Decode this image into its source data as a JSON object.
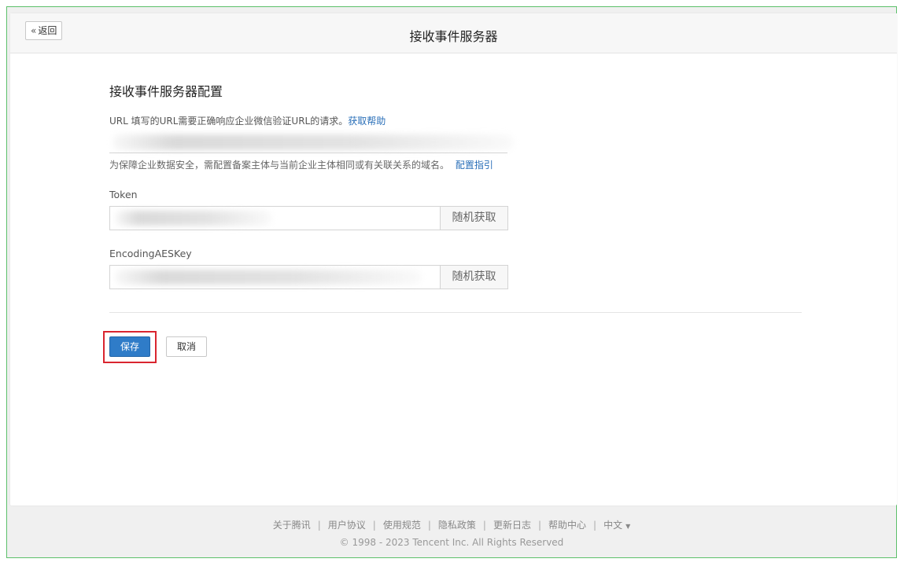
{
  "header": {
    "back_label": "返回",
    "title": "接收事件服务器"
  },
  "form": {
    "section_title": "接收事件服务器配置",
    "url": {
      "label_prefix": "URL  填写的URL需要正确响应企业微信验证URL的请求。",
      "help_link": "获取帮助",
      "hint": "为保障企业数据安全，需配置备案主体与当前企业主体相同或有关联关系的域名。",
      "guide_link": "配置指引"
    },
    "token": {
      "label": "Token",
      "random_button": "随机获取"
    },
    "aes_key": {
      "label": "EncodingAESKey",
      "random_button": "随机获取"
    },
    "save_button": "保存",
    "cancel_button": "取消"
  },
  "footer": {
    "links": [
      "关于腾讯",
      "用户协议",
      "使用规范",
      "隐私政策",
      "更新日志",
      "帮助中心",
      "中文"
    ],
    "copyright": "© 1998 - 2023 Tencent Inc. All Rights Reserved"
  },
  "colors": {
    "primary": "#2f7cc8",
    "link": "#2a6fb8",
    "highlight": "#d9252f",
    "frame_border": "#5cc06a"
  }
}
